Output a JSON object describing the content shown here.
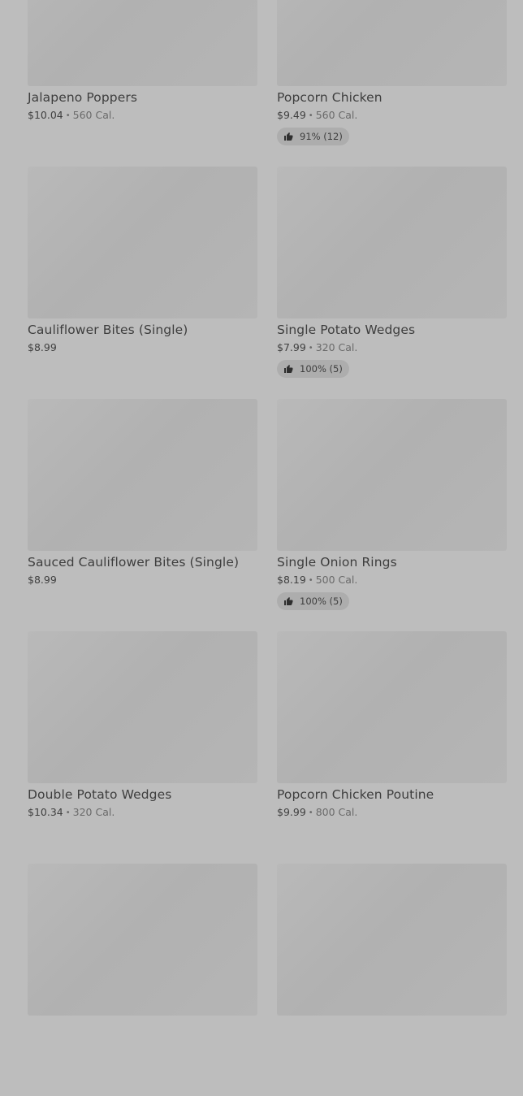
{
  "items": [
    {
      "name": "Jalapeno Poppers",
      "price": "$10.04",
      "calories": "560 Cal.",
      "rating": ""
    },
    {
      "name": "Popcorn Chicken",
      "price": "$9.49",
      "calories": "560 Cal.",
      "rating": "91% (12)"
    },
    {
      "name": "Cauliflower Bites (Single)",
      "price": "$8.99",
      "calories": "",
      "rating": ""
    },
    {
      "name": "Single Potato Wedges",
      "price": "$7.99",
      "calories": "320 Cal.",
      "rating": "100% (5)"
    },
    {
      "name": "Sauced Cauliflower Bites (Single)",
      "price": "$8.99",
      "calories": "",
      "rating": ""
    },
    {
      "name": "Single Onion Rings",
      "price": "$8.19",
      "calories": "500 Cal.",
      "rating": "100% (5)"
    },
    {
      "name": "Double Potato Wedges",
      "price": "$10.34",
      "calories": "320 Cal.",
      "rating": ""
    },
    {
      "name": "Popcorn Chicken Poutine",
      "price": "$9.99",
      "calories": "800 Cal.",
      "rating": ""
    },
    {
      "name": "",
      "price": "",
      "calories": "",
      "rating": ""
    },
    {
      "name": "",
      "price": "",
      "calories": "",
      "rating": ""
    }
  ]
}
